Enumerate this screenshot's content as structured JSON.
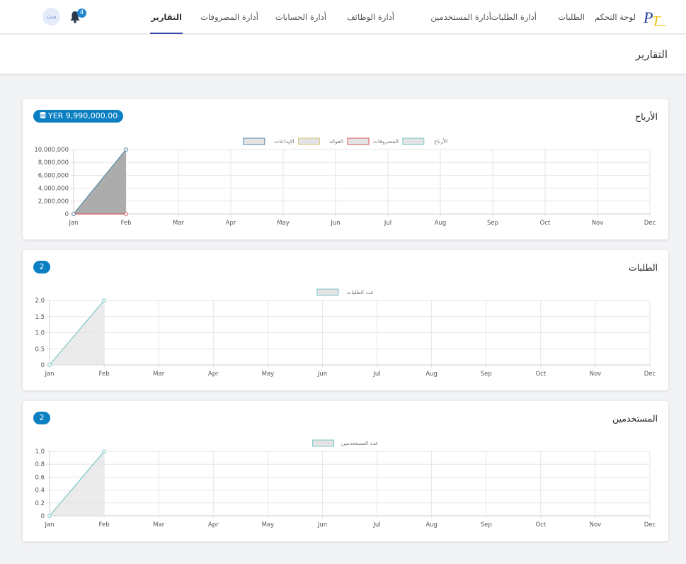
{
  "nav": {
    "items": [
      {
        "label": "لوحة التحكم",
        "right": 71,
        "active": false
      },
      {
        "label": "الطلبات",
        "right": 143,
        "active": false
      },
      {
        "label": "أدارة الطلبات",
        "right": 211,
        "active": false
      },
      {
        "label": "أدارة المستخدمين",
        "right": 275,
        "active": false
      },
      {
        "label": "أدارة الوظائف",
        "right": 412,
        "active": false
      },
      {
        "label": "أدارة الحسابات",
        "right": 508,
        "active": false
      },
      {
        "label": "أدارة المصروفات",
        "right": 604,
        "active": false
      },
      {
        "label": "التقارير",
        "right": 712,
        "active": true
      }
    ],
    "notifications_count": "4",
    "avatar_initials": "مت"
  },
  "page": {
    "title": "التقارير"
  },
  "cards": [
    {
      "title": "الأرباح",
      "badge": "YER 9,990,000.00",
      "chart_data": {
        "type": "area",
        "x": [
          "Jan",
          "Feb",
          "Mar",
          "Apr",
          "May",
          "Jun",
          "Jul",
          "Aug",
          "Sep",
          "Oct",
          "Nov",
          "Dec"
        ],
        "ylim": [
          0,
          10000000
        ],
        "y_ticks": [
          "10,000,000",
          "8,000,000",
          "6,000,000",
          "4,000,000",
          "2,000,000",
          "0"
        ],
        "legend_placement": "top-center",
        "grid": true,
        "series": [
          {
            "name": "الأرباح",
            "values": [
              0,
              9990000
            ],
            "stroke": "#7cc7c7",
            "fill": "#e3e3e3"
          },
          {
            "name": "المصروفات",
            "values": [
              0,
              0
            ],
            "stroke": "#d85a5a",
            "fill": "#e3e3e3"
          },
          {
            "name": "الفوائد",
            "values": [
              0,
              10000000
            ],
            "stroke": "#d7c779",
            "fill": "#bdbdbd"
          },
          {
            "name": "الإيداعات",
            "values": [
              0,
              10000000
            ],
            "stroke": "#5a8bb0",
            "fill": "#9e9e9e"
          }
        ]
      }
    },
    {
      "title": "الطلبات",
      "badge": "2",
      "chart_data": {
        "type": "area",
        "x": [
          "Jan",
          "Feb",
          "Mar",
          "Apr",
          "May",
          "Jun",
          "Jul",
          "Aug",
          "Sep",
          "Oct",
          "Nov",
          "Dec"
        ],
        "ylim": [
          0,
          2
        ],
        "y_ticks": [
          "2.0",
          "1.5",
          "1.0",
          "0.5",
          "0"
        ],
        "legend_placement": "top-center",
        "grid": true,
        "series": [
          {
            "name": "عدد الطلبات",
            "values": [
              0,
              2
            ],
            "stroke": "#7cc7c7",
            "fill": "#e3e3e3"
          }
        ]
      }
    },
    {
      "title": "المستخدمين",
      "badge": "2",
      "chart_data": {
        "type": "area",
        "x": [
          "Jan",
          "Feb",
          "Mar",
          "Apr",
          "May",
          "Jun",
          "Jul",
          "Aug",
          "Sep",
          "Oct",
          "Nov",
          "Dec"
        ],
        "ylim": [
          0,
          1
        ],
        "y_ticks": [
          "1.0",
          "0.8",
          "0.6",
          "0.4",
          "0.2",
          "0"
        ],
        "legend_placement": "top-center",
        "grid": true,
        "series": [
          {
            "name": "عدد المستخدمين",
            "values": [
              0,
              1
            ],
            "stroke": "#7cc7c7",
            "fill": "#e3e3e3"
          }
        ]
      }
    }
  ]
}
